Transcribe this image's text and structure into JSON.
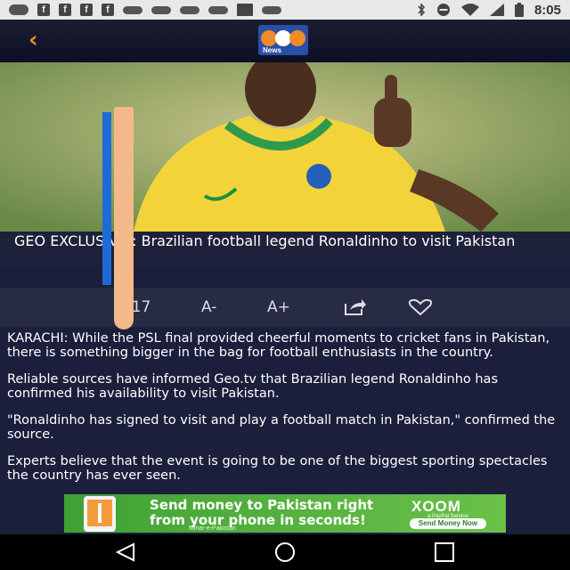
{
  "status_bar": {
    "time": "8:05",
    "left_icons": [
      "message-icon",
      "facebook-icon",
      "facebook-icon",
      "facebook-icon",
      "facebook-icon",
      "voicemail-icon",
      "voicemail-icon",
      "voicemail-icon",
      "voicemail-icon",
      "image-icon",
      "voicemail-icon"
    ],
    "right_icons": [
      "bluetooth-icon",
      "do-not-disturb-icon",
      "wifi-icon",
      "signal-icon",
      "battery-icon"
    ]
  },
  "header": {
    "back_icon": "back-chevron-icon",
    "logo_text": "News",
    "logo_mark": "geo",
    "colors": {
      "accent": "#f08b27",
      "logo_blue": "#2a4fa8"
    }
  },
  "article": {
    "headline": "GEO EXCLUSIVE : Brazilian football legend Ronaldinho to visit Pakistan",
    "headline_visible": "GEO EXC          SIVE : Brazilian football legend Ronaldinho to visit Pa          stan",
    "paragraphs": [
      "KARACHI: While the PSL final provided cheerful moments to cricket fans in Pakistan, there is something bigger in the bag for football enthusiasts in the country.",
      "Reliable sources have informed Geo.tv that Brazilian legend Ronaldinho has confirmed his availability to visit Pakistan.",
      "\"Ronaldinho has signed to visit and play a football match in Pakistan,\" confirmed the source.",
      "Experts believe that the event is going to be one of the biggest sporting spectacles the country has ever seen."
    ]
  },
  "toolbar": {
    "date_partial": "/17",
    "font_decrease": "A-",
    "font_increase": "A+",
    "share_icon": "share-icon",
    "favorite_icon": "heart-icon"
  },
  "ad": {
    "line1": "Send money to Pakistan right",
    "line2": "from your phone in seconds!",
    "sub": "Minar-e-Pakistan",
    "brand": "XOOM",
    "brand_tag": "a PayPal Service",
    "cta": "Send Money Now"
  },
  "nav_bar": {
    "back_icon": "nav-back-icon",
    "home_icon": "nav-home-icon",
    "recents_icon": "nav-recents-icon"
  }
}
